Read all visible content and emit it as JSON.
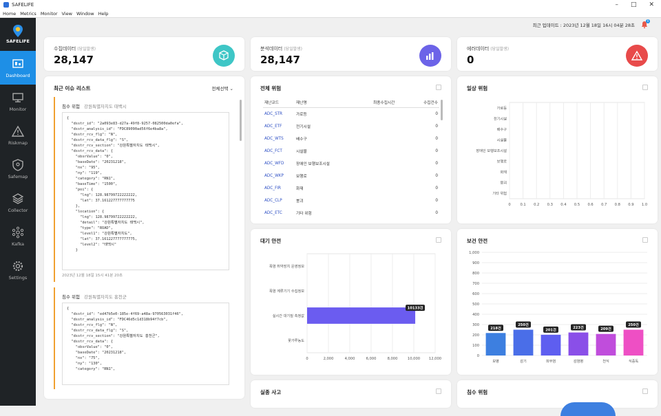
{
  "app": {
    "title": "SAFELIFE",
    "brand": "SAFELIFE"
  },
  "menu": [
    "Home",
    "Metrics",
    "Monitor",
    "View",
    "Window",
    "Help"
  ],
  "nav": [
    {
      "label": "Dashboard",
      "icon": "dashboard-icon"
    },
    {
      "label": "Monitor",
      "icon": "monitor-icon"
    },
    {
      "label": "Riskmap",
      "icon": "warning-icon"
    },
    {
      "label": "Safemap",
      "icon": "shield-icon"
    },
    {
      "label": "Collector",
      "icon": "layers-icon"
    },
    {
      "label": "Kafka",
      "icon": "kafka-icon"
    },
    {
      "label": "Settings",
      "icon": "gear-icon"
    }
  ],
  "topbar": {
    "last_update": "최근 업데이트 : 2023년 12월 18일 16시 04분 28초",
    "notification_count": "0"
  },
  "stats": [
    {
      "label": "수집데이터",
      "sub": "(당일발생)",
      "value": "28,147",
      "color": "#3ec6c6"
    },
    {
      "label": "분석데이터",
      "sub": "(당일발생)",
      "value": "28,147",
      "color": "#6c63e8"
    },
    {
      "label": "에러데이터",
      "sub": "(당일발생)",
      "value": "0",
      "color": "#e84a4a"
    }
  ],
  "issues": {
    "title": "최근 이슈 리스트",
    "filter": "전체선택",
    "items": [
      {
        "type": "침수 위험",
        "location": "강원특별자치도 태백시",
        "json": "{\n  \"dsstr_id\": \"2a093e83-d27a-49f8-9257-082500da0efa\",\n  \"dsstr_analysis_id\": \"FDC89090ad56f6e4ba8a\",\n  \"dsstr_rcv_flg\": \"N\",\n  \"dsstr_rcv_data_flg\": \"S\",\n  \"dsstr_rcv_section\": \"강원특별자치도 태백시\",\n  \"dsstr_rcv_data\": {\n    \"obsrValue\": \"0\",\n    \"baseDate\": \"20231218\",\n    \"nx\": \"95\",\n    \"ny\": \"119\",\n    \"category\": \"RN1\",\n    \"baseTime\": \"1500\",\n    \"poi\": {\n      \"lng\": 128.98799722222222,\n      \"lat\": 37.161227777777775\n    },\n    \"location\": {\n      \"lng\": 128.98799722222222,\n      \"detail\": \"강원특별자치도 태백시\",\n      \"type\": \"ROAD\",\n      \"level1\": \"강원특별자치도\",\n      \"lat\": 37.161227777777775,\n      \"level2\": \"태백시\"\n    }",
        "time": "2023년 12월 18일 15시 41분 20초"
      },
      {
        "type": "침수 위험",
        "location": "강원특별자치도 홍천군",
        "json": "{\n  \"dsstr_id\": \"ed47b5e0-185e-4f69-a48a-970563031f46\",\n  \"dsstr_analysis_id\": \"FDC46d5c1d318b94f7cb\",\n  \"dsstr_rcv_flg\": \"N\",\n  \"dsstr_rcv_data_flg\": \"S\",\n  \"dsstr_rcv_section\": \"강원특별자치도 홍천군\",\n  \"dsstr_rcv_data\": {\n    \"obsrValue\": \"0\",\n    \"baseDate\": \"20231218\",\n    \"nx\": \"75\",\n    \"ny\": \"130\",\n    \"category\": \"RN1\",",
        "time": ""
      }
    ]
  },
  "risk_table": {
    "title": "전체 위험",
    "headers": [
      "재난코드",
      "재난명",
      "최종수집시간",
      "수집건수"
    ],
    "rows": [
      {
        "code": "ADC_STR",
        "name": "가로등",
        "time": "",
        "count": "0"
      },
      {
        "code": "ADC_ETF",
        "name": "전기시설",
        "time": "",
        "count": "0"
      },
      {
        "code": "ADC_WTS",
        "name": "배수구",
        "time": "",
        "count": "0"
      },
      {
        "code": "ADC_FCT",
        "name": "시설물",
        "time": "",
        "count": "0"
      },
      {
        "code": "ADC_WFD",
        "name": "장애인 보행보조시설",
        "time": "",
        "count": "0"
      },
      {
        "code": "ADC_WKP",
        "name": "보행로",
        "time": "",
        "count": "0"
      },
      {
        "code": "ADC_FIR",
        "name": "화재",
        "time": "",
        "count": "0"
      },
      {
        "code": "ADC_CLP",
        "name": "붕괴",
        "time": "",
        "count": "0"
      },
      {
        "code": "ADC_ETC",
        "name": "기타 위험",
        "time": "",
        "count": "0"
      }
    ]
  },
  "panels": {
    "daily": "일상 위험",
    "air": "대기 안전",
    "health": "보건 안전",
    "disaster": "실종 사고",
    "flood": "침수 위험"
  },
  "chart_data": [
    {
      "type": "bar",
      "orientation": "horizontal",
      "title": "일상 위험",
      "categories": [
        "가로등",
        "전기시설",
        "배수구",
        "시설물",
        "장애인 보행보조시설",
        "보행로",
        "화재",
        "붕괴",
        "기타 위험"
      ],
      "values": [
        0,
        0,
        0,
        0,
        0,
        0,
        0,
        0,
        0
      ],
      "xlim": [
        0,
        1
      ],
      "xticks": [
        "0",
        "0.1",
        "0.2",
        "0.3",
        "0.4",
        "0.5",
        "0.6",
        "0.7",
        "0.8",
        "0.9",
        "1.0"
      ]
    },
    {
      "type": "bar",
      "orientation": "horizontal",
      "title": "대기 안전",
      "categories": [
        "폭염 취약장치 운영정보",
        "폭염 계류기기 수집정보",
        "실시간 대기질 측정값",
        "꽃가루농도"
      ],
      "values": [
        0,
        0,
        10133,
        0
      ],
      "labels": [
        "",
        "",
        "10133건",
        ""
      ],
      "xlim": [
        0,
        12000
      ],
      "xticks": [
        "0",
        "2,000",
        "4,000",
        "6,000",
        "8,000",
        "10,000",
        "12,000"
      ],
      "color": "#6b5cf0"
    },
    {
      "type": "bar",
      "title": "보건 안전",
      "categories": [
        "보병",
        "감기",
        "피부염",
        "감염병",
        "천식",
        "식중독"
      ],
      "values": [
        218,
        250,
        201,
        223,
        209,
        250
      ],
      "labels": [
        "218건",
        "250건",
        "201건",
        "223건",
        "209건",
        "250건"
      ],
      "colors": [
        "#3d7fe0",
        "#4a6ee8",
        "#5e5ef0",
        "#8a4fe8",
        "#c04ddc",
        "#ee4fc4"
      ],
      "ylim": [
        0,
        1000
      ],
      "yticks": [
        "0",
        "100",
        "200",
        "300",
        "400",
        "500",
        "600",
        "700",
        "800",
        "900",
        "1,000"
      ]
    }
  ]
}
